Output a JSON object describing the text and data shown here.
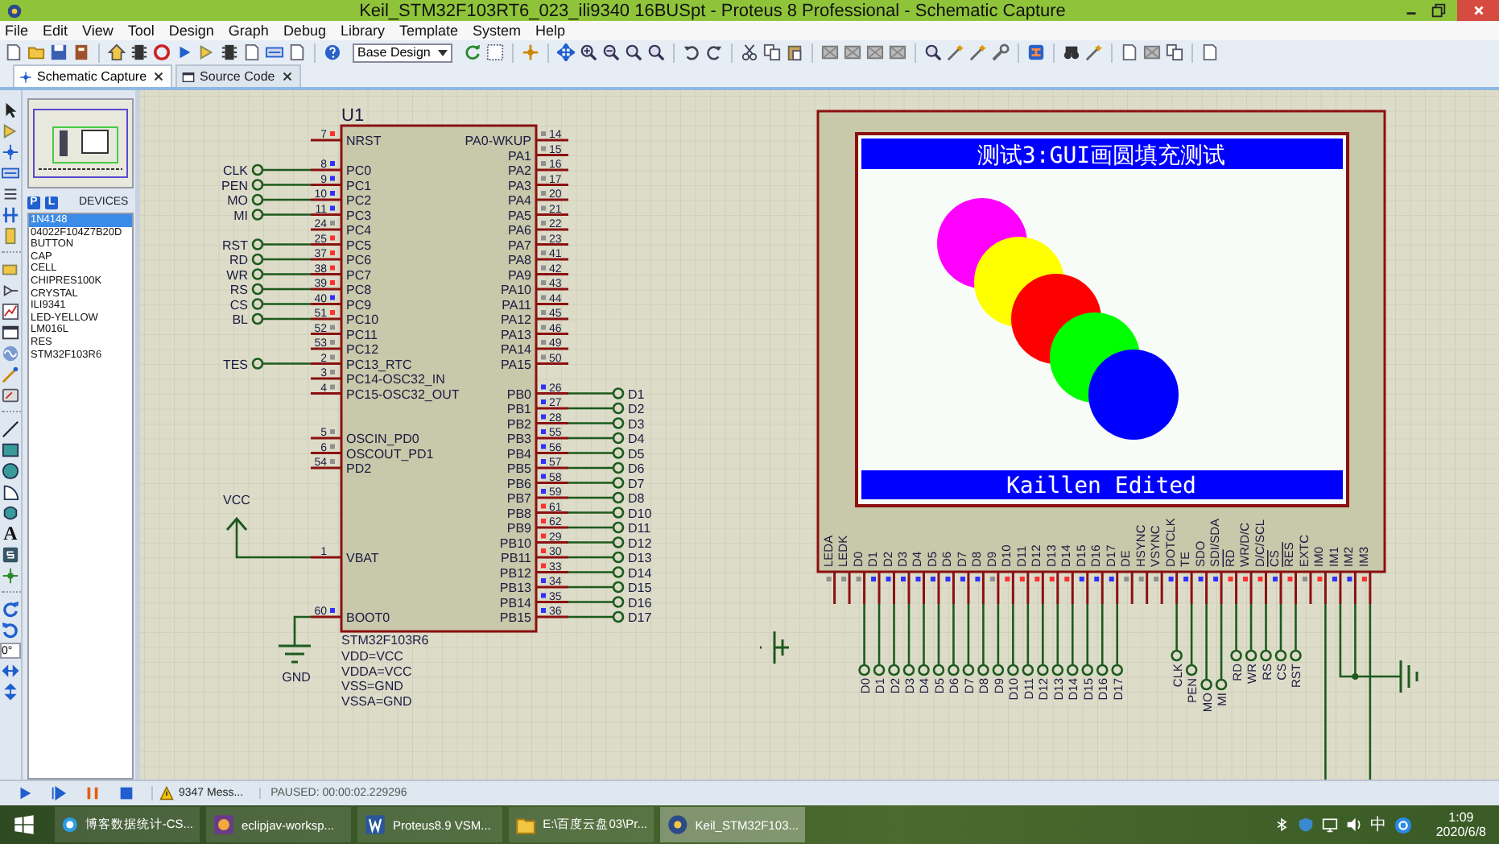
{
  "window": {
    "title": "Keil_STM32F103RT6_023_ili9340 16BUSpt - Proteus 8 Professional - Schematic Capture"
  },
  "menu": [
    "File",
    "Edit",
    "View",
    "Tool",
    "Design",
    "Graph",
    "Debug",
    "Library",
    "Template",
    "System",
    "Help"
  ],
  "toolbar": {
    "design_select": "Base Design"
  },
  "tabs": [
    {
      "label": "Schematic Capture",
      "selected": true
    },
    {
      "label": "Source Code",
      "selected": false
    }
  ],
  "tool_strip": {
    "text_tool": "A",
    "rotation": "0°"
  },
  "devices": {
    "modes": [
      "P",
      "L"
    ],
    "title": "DEVICES",
    "items": [
      {
        "label": "1N4148",
        "selected": true
      },
      {
        "label": "04022F104Z7B20D",
        "selected": false
      },
      {
        "label": "BUTTON",
        "selected": false
      },
      {
        "label": "CAP",
        "selected": false
      },
      {
        "label": "CELL",
        "selected": false
      },
      {
        "label": "CHIPRES100K",
        "selected": false
      },
      {
        "label": "CRYSTAL",
        "selected": false
      },
      {
        "label": "ILI9341",
        "selected": false
      },
      {
        "label": "LED-YELLOW",
        "selected": false
      },
      {
        "label": "LM016L",
        "selected": false
      },
      {
        "label": "RES",
        "selected": false
      },
      {
        "label": "STM32F103R6",
        "selected": false
      }
    ]
  },
  "schematic": {
    "chip": {
      "ref": "U1",
      "left_pins": [
        {
          "num": "7",
          "name": "NRST",
          "color": "#ff3030"
        },
        {
          "num": "8",
          "name": "PC0",
          "color": "#3030ff",
          "net": "CLK"
        },
        {
          "num": "9",
          "name": "PC1",
          "color": "#3030ff",
          "net": "PEN"
        },
        {
          "num": "10",
          "name": "PC2",
          "color": "#3030ff",
          "net": "MO"
        },
        {
          "num": "11",
          "name": "PC3",
          "color": "#3030ff",
          "net": "MI"
        },
        {
          "num": "24",
          "name": "PC4",
          "color": "#909090"
        },
        {
          "num": "25",
          "name": "PC5",
          "color": "#ff3030",
          "net": "RST"
        },
        {
          "num": "37",
          "name": "PC6",
          "color": "#ff3030",
          "net": "RD"
        },
        {
          "num": "38",
          "name": "PC7",
          "color": "#ff3030",
          "net": "WR"
        },
        {
          "num": "39",
          "name": "PC8",
          "color": "#ff3030",
          "net": "RS"
        },
        {
          "num": "40",
          "name": "PC9",
          "color": "#3030ff",
          "net": "CS"
        },
        {
          "num": "51",
          "name": "PC10",
          "color": "#ff3030",
          "net": "BL"
        },
        {
          "num": "52",
          "name": "PC11",
          "color": "#909090"
        },
        {
          "num": "53",
          "name": "PC12",
          "color": "#909090"
        },
        {
          "num": "2",
          "name": "PC13_RTC",
          "color": "#909090",
          "net": "TES"
        },
        {
          "num": "3",
          "name": "PC14-OSC32_IN",
          "color": "#909090"
        },
        {
          "num": "4",
          "name": "PC15-OSC32_OUT",
          "color": "#909090"
        },
        {
          "num": "5",
          "name": "OSCIN_PD0",
          "color": "#909090"
        },
        {
          "num": "6",
          "name": "OSCOUT_PD1",
          "color": "#909090"
        },
        {
          "num": "54",
          "name": "PD2",
          "color": "#909090"
        },
        {
          "num": "1",
          "name": "VBAT"
        },
        {
          "num": "60",
          "name": "BOOT0",
          "color": "#3030ff"
        }
      ],
      "right_pins": [
        {
          "num": "14",
          "name": "PA0-WKUP",
          "color": "#909090"
        },
        {
          "num": "15",
          "name": "PA1",
          "color": "#909090"
        },
        {
          "num": "16",
          "name": "PA2",
          "color": "#909090"
        },
        {
          "num": "17",
          "name": "PA3",
          "color": "#909090"
        },
        {
          "num": "20",
          "name": "PA4",
          "color": "#909090"
        },
        {
          "num": "21",
          "name": "PA5",
          "color": "#909090"
        },
        {
          "num": "22",
          "name": "PA6",
          "color": "#909090"
        },
        {
          "num": "23",
          "name": "PA7",
          "color": "#909090"
        },
        {
          "num": "41",
          "name": "PA8",
          "color": "#909090"
        },
        {
          "num": "42",
          "name": "PA9",
          "color": "#909090"
        },
        {
          "num": "43",
          "name": "PA10",
          "color": "#909090"
        },
        {
          "num": "44",
          "name": "PA11",
          "color": "#909090"
        },
        {
          "num": "45",
          "name": "PA12",
          "color": "#909090"
        },
        {
          "num": "46",
          "name": "PA13",
          "color": "#909090"
        },
        {
          "num": "49",
          "name": "PA14",
          "color": "#909090"
        },
        {
          "num": "50",
          "name": "PA15",
          "color": "#909090"
        },
        {
          "num": "26",
          "name": "PB0",
          "color": "#3030ff",
          "net": "D1"
        },
        {
          "num": "27",
          "name": "PB1",
          "color": "#3030ff",
          "net": "D2"
        },
        {
          "num": "28",
          "name": "PB2",
          "color": "#3030ff",
          "net": "D3"
        },
        {
          "num": "55",
          "name": "PB3",
          "color": "#3030ff",
          "net": "D4"
        },
        {
          "num": "56",
          "name": "PB4",
          "color": "#3030ff",
          "net": "D5"
        },
        {
          "num": "57",
          "name": "PB5",
          "color": "#3030ff",
          "net": "D6"
        },
        {
          "num": "58",
          "name": "PB6",
          "color": "#3030ff",
          "net": "D7"
        },
        {
          "num": "59",
          "name": "PB7",
          "color": "#3030ff",
          "net": "D8"
        },
        {
          "num": "61",
          "name": "PB8",
          "color": "#ff3030",
          "net": "D10"
        },
        {
          "num": "62",
          "name": "PB9",
          "color": "#ff3030",
          "net": "D11"
        },
        {
          "num": "29",
          "name": "PB10",
          "color": "#ff3030",
          "net": "D12"
        },
        {
          "num": "30",
          "name": "PB11",
          "color": "#ff3030",
          "net": "D13"
        },
        {
          "num": "33",
          "name": "PB12",
          "color": "#ff3030",
          "net": "D14"
        },
        {
          "num": "34",
          "name": "PB13",
          "color": "#3030ff",
          "net": "D15"
        },
        {
          "num": "35",
          "name": "PB14",
          "color": "#3030ff",
          "net": "D16"
        },
        {
          "num": "36",
          "name": "PB15",
          "color": "#3030ff",
          "net": "D17"
        }
      ],
      "part": "STM32F103R6",
      "props": [
        "VDD=VCC",
        "VDDA=VCC",
        "VSS=GND",
        "VSSA=GND"
      ]
    },
    "vcc": "VCC",
    "gnd": "GND",
    "lcd": {
      "title": "测试3:GUI画圆填充测试",
      "footer": "Kaillen Edited",
      "circles": [
        {
          "color": "#ff00ff"
        },
        {
          "color": "#ffff00"
        },
        {
          "color": "#ff0000"
        },
        {
          "color": "#00ff00"
        },
        {
          "color": "#0000ff"
        }
      ],
      "pins": [
        {
          "name": "LEDA",
          "color": "#909090",
          "inverted": false
        },
        {
          "name": "LEDK",
          "color": "#909090",
          "inverted": false
        },
        {
          "name": "D0",
          "color": "#909090",
          "inverted": false,
          "net": "D0"
        },
        {
          "name": "D1",
          "color": "#3030ff",
          "inverted": false,
          "net": "D1"
        },
        {
          "name": "D2",
          "color": "#3030ff",
          "inverted": false,
          "net": "D2"
        },
        {
          "name": "D3",
          "color": "#3030ff",
          "inverted": false,
          "net": "D3"
        },
        {
          "name": "D4",
          "color": "#3030ff",
          "inverted": false,
          "net": "D4"
        },
        {
          "name": "D5",
          "color": "#3030ff",
          "inverted": false,
          "net": "D5"
        },
        {
          "name": "D6",
          "color": "#3030ff",
          "inverted": false,
          "net": "D6"
        },
        {
          "name": "D7",
          "color": "#3030ff",
          "inverted": false,
          "net": "D7"
        },
        {
          "name": "D8",
          "color": "#3030ff",
          "inverted": false,
          "net": "D8"
        },
        {
          "name": "D9",
          "color": "#909090",
          "inverted": false,
          "net": "D9"
        },
        {
          "name": "D10",
          "color": "#ff3030",
          "inverted": false,
          "net": "D10"
        },
        {
          "name": "D11",
          "color": "#ff3030",
          "inverted": false,
          "net": "D11"
        },
        {
          "name": "D12",
          "color": "#ff3030",
          "inverted": false,
          "net": "D12"
        },
        {
          "name": "D13",
          "color": "#ff3030",
          "inverted": false,
          "net": "D13"
        },
        {
          "name": "D14",
          "color": "#ff3030",
          "inverted": false,
          "net": "D14"
        },
        {
          "name": "D15",
          "color": "#3030ff",
          "inverted": false,
          "net": "D15"
        },
        {
          "name": "D16",
          "color": "#3030ff",
          "inverted": false,
          "net": "D16"
        },
        {
          "name": "D17",
          "color": "#3030ff",
          "inverted": false,
          "net": "D17"
        },
        {
          "name": "DE",
          "color": "#909090",
          "inverted": false
        },
        {
          "name": "HSYNC",
          "color": "#909090",
          "inverted": false
        },
        {
          "name": "VSYNC",
          "color": "#909090",
          "inverted": false
        },
        {
          "name": "DOTCLK",
          "color": "#3030ff",
          "inverted": false,
          "net": "CLK"
        },
        {
          "name": "TE",
          "color": "#3030ff",
          "inverted": false,
          "net": "PEN"
        },
        {
          "name": "SDO",
          "color": "#3030ff",
          "inverted": false,
          "net": "MO"
        },
        {
          "name": "SDI/SDA",
          "color": "#3030ff",
          "inverted": false,
          "net": "MI"
        },
        {
          "name": "RD",
          "color": "#ff3030",
          "inverted": true,
          "net": "RD"
        },
        {
          "name": "WR/D/C",
          "color": "#ff3030",
          "inverted": false,
          "net": "WR"
        },
        {
          "name": "D/C/SCL",
          "color": "#ff3030",
          "inverted": false,
          "net": "RS"
        },
        {
          "name": "CS",
          "color": "#3030ff",
          "inverted": true,
          "net": "CS"
        },
        {
          "name": "RES",
          "color": "#ff3030",
          "inverted": true,
          "net": "RST"
        },
        {
          "name": "EXTC",
          "color": "#909090",
          "inverted": false
        },
        {
          "name": "IM0",
          "color": "#ff3030",
          "inverted": false
        },
        {
          "name": "IM1",
          "color": "#3030ff",
          "inverted": false
        },
        {
          "name": "IM2",
          "color": "#3030ff",
          "inverted": false
        },
        {
          "name": "IM3",
          "color": "#ff3030",
          "inverted": false
        }
      ]
    }
  },
  "status_bar": {
    "messages": "9347 Mess...",
    "state": "PAUSED: 00:00:02.229296"
  },
  "taskbar": {
    "tasks": [
      {
        "label": "博客数据统计-CS...",
        "selected": false
      },
      {
        "label": "eclipjav-worksp...",
        "selected": false
      },
      {
        "label": "Proteus8.9 VSM...",
        "selected": false
      },
      {
        "label": "E:\\百度云盘03\\Pr...",
        "selected": false
      },
      {
        "label": "Keil_STM32F103...",
        "selected": true
      }
    ],
    "ime": "中",
    "time": "1:09",
    "date": "2020/6/8"
  }
}
